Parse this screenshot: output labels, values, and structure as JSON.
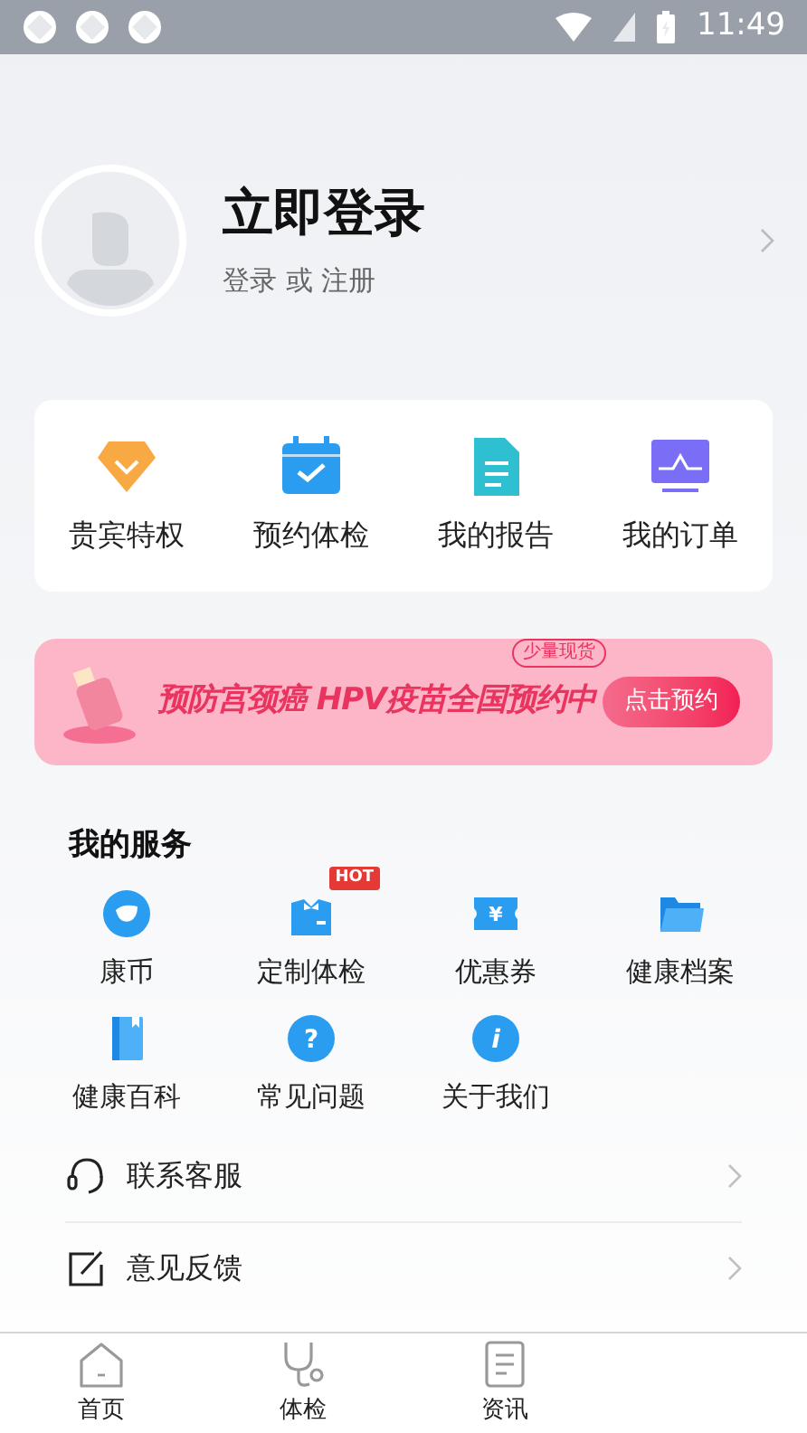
{
  "status_bar": {
    "time": "11:49"
  },
  "profile": {
    "title": "立即登录",
    "subtitle": "登录 或 注册"
  },
  "quick_actions": [
    {
      "kind": "vip",
      "label": "贵宾特权"
    },
    {
      "kind": "calendar",
      "label": "预约体检"
    },
    {
      "kind": "report",
      "label": "我的报告"
    },
    {
      "kind": "order",
      "label": "我的订单"
    }
  ],
  "banner": {
    "tag": "少量现货",
    "text": "预防宫颈癌 HPV疫苗全国预约中",
    "button": "点击预约"
  },
  "services": {
    "title": "我的服务",
    "items": [
      {
        "kind": "coin",
        "label": "康币"
      },
      {
        "kind": "custom",
        "label": "定制体检",
        "badge": "HOT"
      },
      {
        "kind": "coupon",
        "label": "优惠券",
        "icon_text": "¥"
      },
      {
        "kind": "folder",
        "label": "健康档案"
      },
      {
        "kind": "book",
        "label": "健康百科"
      },
      {
        "kind": "question",
        "label": "常见问题",
        "icon_text": "?"
      },
      {
        "kind": "info",
        "label": "关于我们",
        "icon_text": "i"
      }
    ]
  },
  "menu": [
    {
      "kind": "headset",
      "label": "联系客服"
    },
    {
      "kind": "feedback",
      "label": "意见反馈"
    }
  ],
  "tab_bar": [
    {
      "kind": "home",
      "label": "首页",
      "selected": false
    },
    {
      "kind": "stethoscope",
      "label": "体检",
      "selected": false
    },
    {
      "kind": "news",
      "label": "资讯",
      "selected": false
    }
  ]
}
